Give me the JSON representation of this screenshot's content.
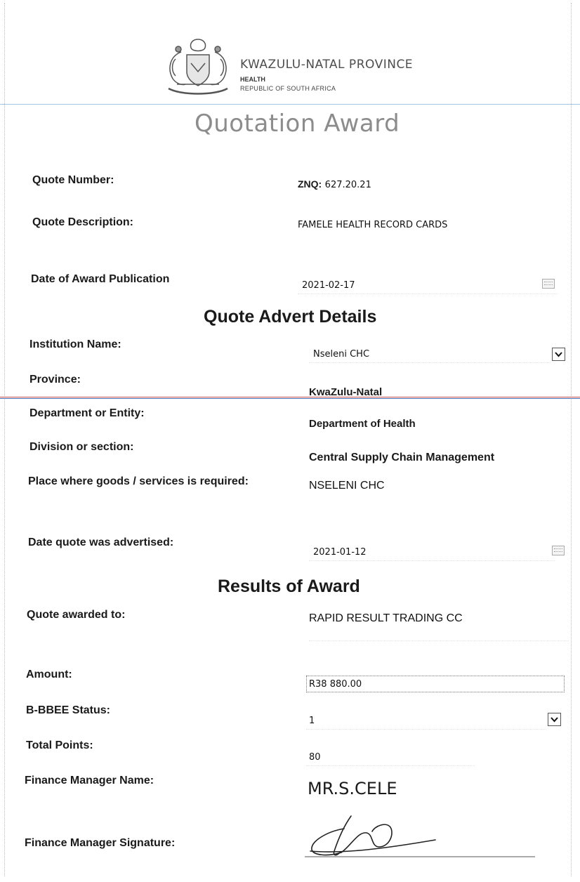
{
  "header": {
    "province": "KWAZULU-NATAL PROVINCE",
    "department": "HEALTH",
    "republic": "REPUBLIC OF SOUTH AFRICA",
    "emblem_icon": "coat-of-arms"
  },
  "title": "Quotation Award",
  "quote": {
    "number_label": "Quote Number:",
    "number_prefix": "ZNQ:",
    "number_value": "627.20.21",
    "description_label": "Quote Description:",
    "description_value": "FAMELE HEALTH RECORD CARDS",
    "award_date_label": "Date of Award Publication",
    "award_date_value": "2021-02-17"
  },
  "advert": {
    "heading": "Quote Advert Details",
    "institution_label": "Institution Name:",
    "institution_value": "Nseleni CHC",
    "province_label": "Province:",
    "province_value": "KwaZulu-Natal",
    "department_label": "Department or Entity:",
    "department_value": "Department of Health",
    "division_label": "Division or section:",
    "division_value": "Central Supply Chain Management",
    "place_label": "Place where goods /  services is required:",
    "place_value": "NSELENI CHC",
    "advertised_label": "Date quote was advertised:",
    "advertised_value": "2021-01-12"
  },
  "results": {
    "heading": "Results of Award",
    "awarded_label": "Quote awarded to:",
    "awarded_value": "RAPID RESULT TRADING CC",
    "amount_label": "Amount:",
    "amount_value": "R38 880.00",
    "bbbee_label": "B-BBEE Status:",
    "bbbee_value": "1",
    "points_label": "Total Points:",
    "points_value": "80",
    "manager_label": "Finance Manager Name:",
    "manager_value": "MR.S.CELE",
    "signature_label": "Finance Manager Signature:"
  },
  "colors": {
    "rule_blue": "#4a6fb5",
    "rule_red": "#c0504d",
    "title_gray": "#8c8c8c"
  }
}
